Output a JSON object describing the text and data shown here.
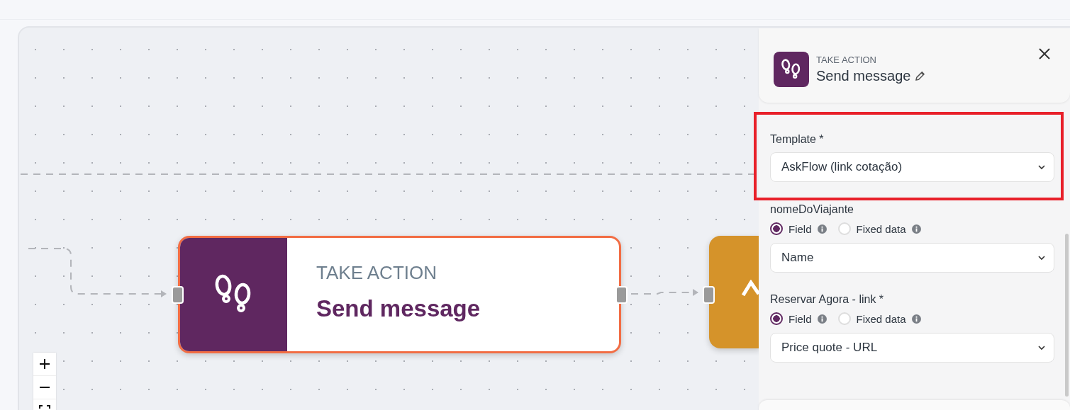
{
  "canvas": {
    "nodes": [
      {
        "kind": "action",
        "category": "TAKE ACTION",
        "title": "Send message",
        "selected": true
      },
      {
        "kind": "condition",
        "selected": false
      }
    ]
  },
  "panel": {
    "category": "TAKE ACTION",
    "title": "Send message",
    "fields": [
      {
        "kind": "select",
        "label": "Template *",
        "value": "AskFlow (link cotação)",
        "highlighted": true
      },
      {
        "kind": "mapping",
        "label": "nomeDoViajante",
        "options": [
          {
            "label": "Field",
            "selected": true
          },
          {
            "label": "Fixed data",
            "selected": false
          }
        ],
        "value": "Name",
        "highlighted": false
      },
      {
        "kind": "mapping",
        "label": "Reservar Agora - link *",
        "options": [
          {
            "label": "Field",
            "selected": true
          },
          {
            "label": "Fixed data",
            "selected": false
          }
        ],
        "value": "Price quote - URL",
        "highlighted": false
      }
    ]
  }
}
